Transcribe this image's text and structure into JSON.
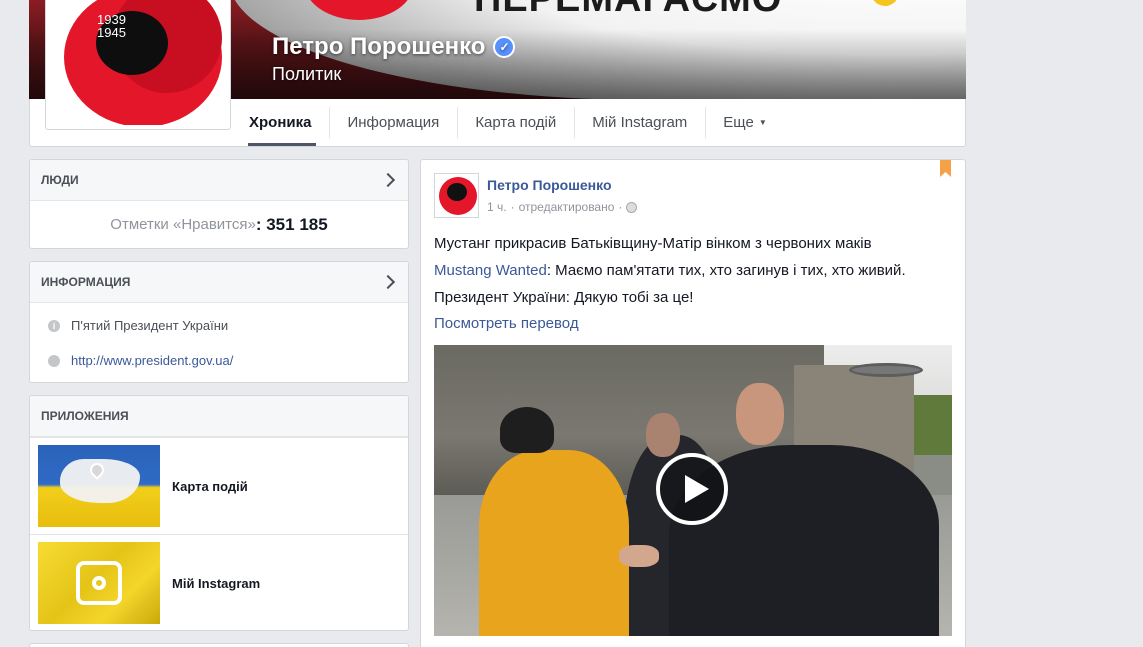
{
  "cover": {
    "banner_text": "ПЕРЕМАГАЄМО",
    "colors": {
      "poppy_red": "#e3162a",
      "accent_yellow": "#f4c51b"
    }
  },
  "page": {
    "name": "Петро Порошенко",
    "category": "Политик",
    "profile_years": [
      "1939",
      "1945"
    ],
    "verified": true
  },
  "tabs": [
    {
      "label": "Хроника",
      "active": true
    },
    {
      "label": "Информация",
      "active": false
    },
    {
      "label": "Карта подій",
      "active": false
    },
    {
      "label": "Мій Instagram",
      "active": false
    },
    {
      "label": "Еще",
      "active": false,
      "has_dropdown": true
    }
  ],
  "people": {
    "title": "ЛЮДИ",
    "likes_label": "Отметки «Нравится»",
    "likes_count": ": 351 185"
  },
  "info": {
    "title": "ИНФОРМАЦИЯ",
    "items": [
      {
        "icon": "info-icon",
        "text": "П'ятий Президент України"
      },
      {
        "icon": "globe-icon",
        "text": "http://www.president.gov.ua/"
      }
    ]
  },
  "apps": {
    "title": "ПРИЛОЖЕНИЯ",
    "items": [
      {
        "label": "Карта подій",
        "icon": "ukraine-map-icon"
      },
      {
        "label": "Мій Instagram",
        "icon": "instagram-camera-icon"
      }
    ]
  },
  "post": {
    "author": "Петро Порошенко",
    "time": "1 ч.",
    "separator": "·",
    "edited": "отредактировано",
    "lines": [
      {
        "prefix": "",
        "text": "Мустанг прикрасив Батьківщину-Матір вінком з червоних маків"
      },
      {
        "prefix": "Mustang Wanted",
        "text": ": Маємо пам'ятати тих, хто загинув і тих, хто живий."
      },
      {
        "prefix": "",
        "text": "Президент України: Дякую тобі за це!"
      }
    ],
    "translate_label": "Посмотреть перевод",
    "media": "video",
    "bookmark_color": "#f5a146"
  }
}
